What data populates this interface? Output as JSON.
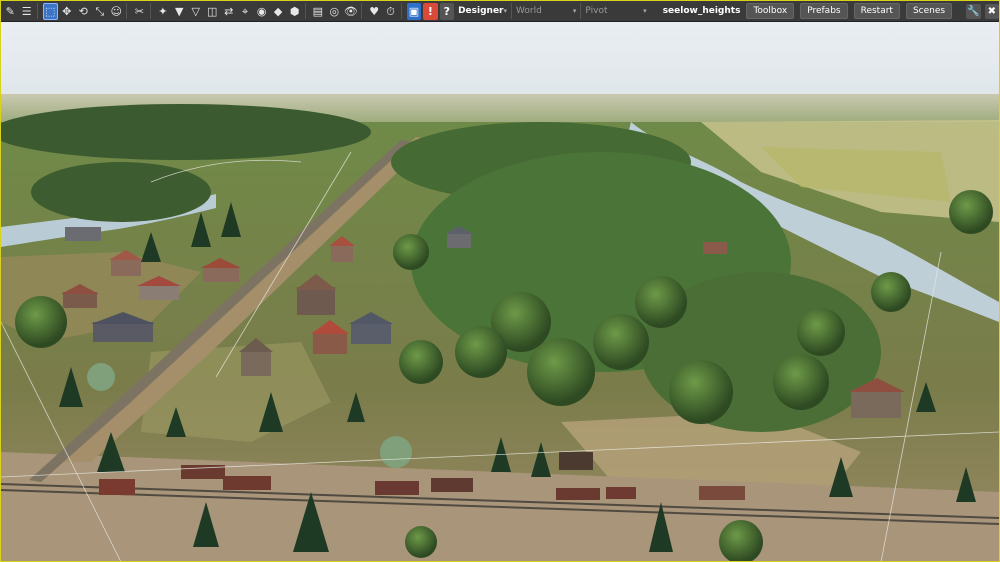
{
  "toolbar": {
    "mode": "Designer",
    "space": "World",
    "pivot": "Pivot",
    "scene_name": "seelow_heights",
    "toolbox_label": "Toolbox",
    "prefabs_label": "Prefabs",
    "restart_label": "Restart",
    "scenes_label": "Scenes"
  },
  "colors": {
    "border": "#d9d21a",
    "toolbar": "#3a3a3a",
    "active_tool": "#3b73c6",
    "warning": "#d94a3a"
  }
}
